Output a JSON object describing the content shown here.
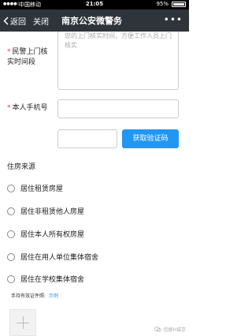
{
  "status_bar": {
    "carrier": "中国移动",
    "time": "21:05",
    "battery": "95%"
  },
  "nav": {
    "back_label": "返回",
    "close_label": "关闭",
    "title": "南京公安微警务",
    "more": "•••"
  },
  "form": {
    "verify_time": {
      "label": "民警上门核实时间段",
      "placeholder": "您的上门核实时间，方便工作人员上门核实"
    },
    "phone": {
      "label": "本人手机号",
      "value": ""
    },
    "code": {
      "value": "",
      "button": "获取验证码"
    },
    "housing_source": {
      "title": "住房来源",
      "options": [
        "居住租赁房屋",
        "居住非租赁他人房屋",
        "居住本人所有权房屋",
        "居住在用人单位集体宿舍",
        "居住在学校集体宿舍"
      ]
    },
    "document": {
      "label": "手持有效证件照:",
      "example_link": "示例"
    }
  },
  "watermark": "信据H城京"
}
